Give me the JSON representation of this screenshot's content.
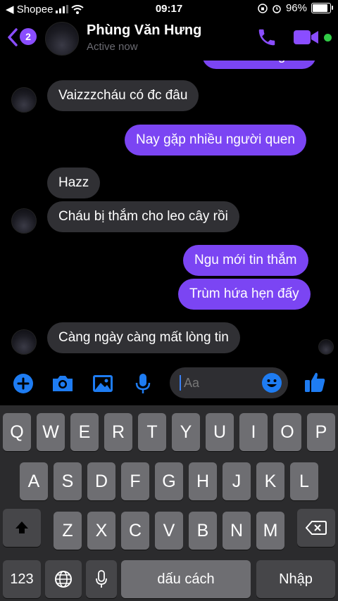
{
  "status_bar": {
    "carrier": "◀ Shopee",
    "time": "09:17",
    "battery": "96%",
    "battery_level": 0.96
  },
  "header": {
    "back_badge": "2",
    "name": "Phùng Văn Hưng",
    "presence": "Active now"
  },
  "messages": [
    {
      "dir": "out",
      "text": "Có làu dung k"
    },
    {
      "dir": "in",
      "text": "Vaizzzcháu có đc đâu"
    },
    {
      "dir": "out",
      "text": "Nay gặp nhiều người quen"
    },
    {
      "dir": "in",
      "text": "Hazz"
    },
    {
      "dir": "in",
      "text": "Cháu bị thắm cho leo cây rồi"
    },
    {
      "dir": "out",
      "text": "Ngu mới tin thắm"
    },
    {
      "dir": "out",
      "text": "Trùm hứa hẹn đấy"
    },
    {
      "dir": "in",
      "text": "Càng ngày càng mất lòng tin"
    }
  ],
  "composer": {
    "placeholder": "Aa"
  },
  "keyboard": {
    "row1": [
      "Q",
      "W",
      "E",
      "R",
      "T",
      "Y",
      "U",
      "I",
      "O",
      "P"
    ],
    "row2": [
      "A",
      "S",
      "D",
      "F",
      "G",
      "H",
      "J",
      "K",
      "L"
    ],
    "row3": [
      "Z",
      "X",
      "C",
      "V",
      "B",
      "N",
      "M"
    ],
    "numbers_key": "123",
    "space_key": "dấu cách",
    "return_key": "Nhập"
  },
  "colors": {
    "accent": "#8a4dff",
    "outgoing_bubble": "#7b45f3",
    "incoming_bubble": "#303034",
    "blue_icon": "#1e7cf2",
    "online": "#31cc46"
  },
  "icons": [
    "back-chevron-icon",
    "phone-icon",
    "video-camera-icon",
    "plus-icon",
    "camera-icon",
    "image-icon",
    "microphone-icon",
    "emoji-icon",
    "thumbs-up-icon",
    "shift-icon",
    "backspace-icon",
    "globe-icon"
  ]
}
